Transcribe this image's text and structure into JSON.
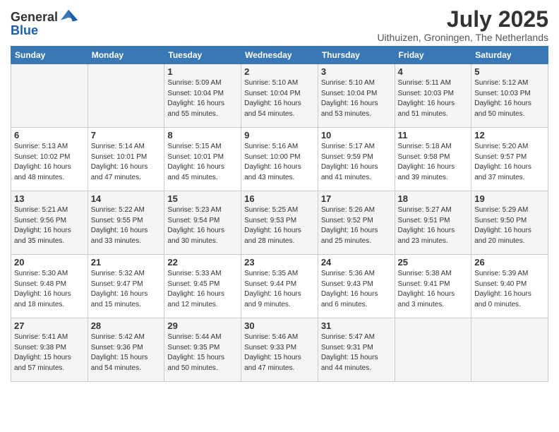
{
  "header": {
    "logo_general": "General",
    "logo_blue": "Blue",
    "month_title": "July 2025",
    "location": "Uithuizen, Groningen, The Netherlands"
  },
  "weekdays": [
    "Sunday",
    "Monday",
    "Tuesday",
    "Wednesday",
    "Thursday",
    "Friday",
    "Saturday"
  ],
  "weeks": [
    [
      {
        "day": "",
        "info": ""
      },
      {
        "day": "",
        "info": ""
      },
      {
        "day": "1",
        "info": "Sunrise: 5:09 AM\nSunset: 10:04 PM\nDaylight: 16 hours\nand 55 minutes."
      },
      {
        "day": "2",
        "info": "Sunrise: 5:10 AM\nSunset: 10:04 PM\nDaylight: 16 hours\nand 54 minutes."
      },
      {
        "day": "3",
        "info": "Sunrise: 5:10 AM\nSunset: 10:04 PM\nDaylight: 16 hours\nand 53 minutes."
      },
      {
        "day": "4",
        "info": "Sunrise: 5:11 AM\nSunset: 10:03 PM\nDaylight: 16 hours\nand 51 minutes."
      },
      {
        "day": "5",
        "info": "Sunrise: 5:12 AM\nSunset: 10:03 PM\nDaylight: 16 hours\nand 50 minutes."
      }
    ],
    [
      {
        "day": "6",
        "info": "Sunrise: 5:13 AM\nSunset: 10:02 PM\nDaylight: 16 hours\nand 48 minutes."
      },
      {
        "day": "7",
        "info": "Sunrise: 5:14 AM\nSunset: 10:01 PM\nDaylight: 16 hours\nand 47 minutes."
      },
      {
        "day": "8",
        "info": "Sunrise: 5:15 AM\nSunset: 10:01 PM\nDaylight: 16 hours\nand 45 minutes."
      },
      {
        "day": "9",
        "info": "Sunrise: 5:16 AM\nSunset: 10:00 PM\nDaylight: 16 hours\nand 43 minutes."
      },
      {
        "day": "10",
        "info": "Sunrise: 5:17 AM\nSunset: 9:59 PM\nDaylight: 16 hours\nand 41 minutes."
      },
      {
        "day": "11",
        "info": "Sunrise: 5:18 AM\nSunset: 9:58 PM\nDaylight: 16 hours\nand 39 minutes."
      },
      {
        "day": "12",
        "info": "Sunrise: 5:20 AM\nSunset: 9:57 PM\nDaylight: 16 hours\nand 37 minutes."
      }
    ],
    [
      {
        "day": "13",
        "info": "Sunrise: 5:21 AM\nSunset: 9:56 PM\nDaylight: 16 hours\nand 35 minutes."
      },
      {
        "day": "14",
        "info": "Sunrise: 5:22 AM\nSunset: 9:55 PM\nDaylight: 16 hours\nand 33 minutes."
      },
      {
        "day": "15",
        "info": "Sunrise: 5:23 AM\nSunset: 9:54 PM\nDaylight: 16 hours\nand 30 minutes."
      },
      {
        "day": "16",
        "info": "Sunrise: 5:25 AM\nSunset: 9:53 PM\nDaylight: 16 hours\nand 28 minutes."
      },
      {
        "day": "17",
        "info": "Sunrise: 5:26 AM\nSunset: 9:52 PM\nDaylight: 16 hours\nand 25 minutes."
      },
      {
        "day": "18",
        "info": "Sunrise: 5:27 AM\nSunset: 9:51 PM\nDaylight: 16 hours\nand 23 minutes."
      },
      {
        "day": "19",
        "info": "Sunrise: 5:29 AM\nSunset: 9:50 PM\nDaylight: 16 hours\nand 20 minutes."
      }
    ],
    [
      {
        "day": "20",
        "info": "Sunrise: 5:30 AM\nSunset: 9:48 PM\nDaylight: 16 hours\nand 18 minutes."
      },
      {
        "day": "21",
        "info": "Sunrise: 5:32 AM\nSunset: 9:47 PM\nDaylight: 16 hours\nand 15 minutes."
      },
      {
        "day": "22",
        "info": "Sunrise: 5:33 AM\nSunset: 9:45 PM\nDaylight: 16 hours\nand 12 minutes."
      },
      {
        "day": "23",
        "info": "Sunrise: 5:35 AM\nSunset: 9:44 PM\nDaylight: 16 hours\nand 9 minutes."
      },
      {
        "day": "24",
        "info": "Sunrise: 5:36 AM\nSunset: 9:43 PM\nDaylight: 16 hours\nand 6 minutes."
      },
      {
        "day": "25",
        "info": "Sunrise: 5:38 AM\nSunset: 9:41 PM\nDaylight: 16 hours\nand 3 minutes."
      },
      {
        "day": "26",
        "info": "Sunrise: 5:39 AM\nSunset: 9:40 PM\nDaylight: 16 hours\nand 0 minutes."
      }
    ],
    [
      {
        "day": "27",
        "info": "Sunrise: 5:41 AM\nSunset: 9:38 PM\nDaylight: 15 hours\nand 57 minutes."
      },
      {
        "day": "28",
        "info": "Sunrise: 5:42 AM\nSunset: 9:36 PM\nDaylight: 15 hours\nand 54 minutes."
      },
      {
        "day": "29",
        "info": "Sunrise: 5:44 AM\nSunset: 9:35 PM\nDaylight: 15 hours\nand 50 minutes."
      },
      {
        "day": "30",
        "info": "Sunrise: 5:46 AM\nSunset: 9:33 PM\nDaylight: 15 hours\nand 47 minutes."
      },
      {
        "day": "31",
        "info": "Sunrise: 5:47 AM\nSunset: 9:31 PM\nDaylight: 15 hours\nand 44 minutes."
      },
      {
        "day": "",
        "info": ""
      },
      {
        "day": "",
        "info": ""
      }
    ]
  ]
}
